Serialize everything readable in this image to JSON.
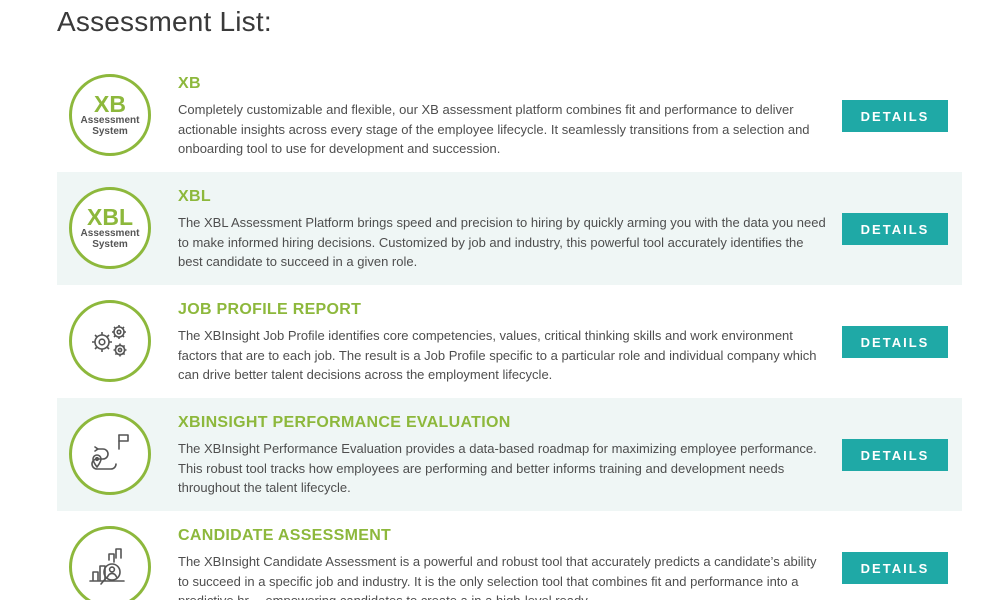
{
  "page": {
    "title": "Assessment List:"
  },
  "colors": {
    "accent": "#8db83c",
    "button": "#1fa9a6",
    "shaded_row": "#eff6f5"
  },
  "assessments": [
    {
      "logo": {
        "main": "XB",
        "sub": "Assessment System"
      },
      "icon": "xb-logo-icon",
      "title": "XB",
      "description": "Completely customizable and flexible, our XB assessment platform combines fit and performance to deliver actionable insights across every stage of the employee lifecycle. It seamlessly transitions from a selection and onboarding tool to use for development and succession.",
      "button": "DETAILS"
    },
    {
      "logo": {
        "main": "XBL",
        "sub": "Assessment System"
      },
      "icon": "xbl-logo-icon",
      "title": "XBL",
      "description": "The XBL Assessment Platform brings speed and precision to hiring by quickly arming you with the data you need to make informed hiring decisions. Customized by job and industry, this powerful tool accurately identifies the best candidate to succeed in a given role.",
      "button": "DETAILS"
    },
    {
      "icon": "gears-icon",
      "title": "JOB PROFILE REPORT",
      "description": "The XBInsight Job Profile identifies core competencies, values, critical thinking skills and work environment factors that are to each job. The result is a Job Profile specific to a particular role and individual company which can drive better talent decisions across the employment lifecycle.",
      "button": "DETAILS"
    },
    {
      "icon": "roadmap-icon",
      "title": "XBINSIGHT PERFORMANCE EVALUATION",
      "description": "The XBInsight Performance Evaluation provides a data-based roadmap for maximizing employee performance. This robust tool tracks how employees are performing and better informs training and development needs throughout the talent lifecycle.",
      "button": "DETAILS"
    },
    {
      "icon": "candidate-search-icon",
      "title": "CANDIDATE ASSESSMENT",
      "description": "The XBInsight Candidate Assessment is a powerful and robust tool that accurately predicts a candidate’s ability to succeed in a specific job and industry. It is the only selection tool that combines fit and performance into a predictive hr… empowering candidates to create a in a high-level ready",
      "button": "DETAILS"
    }
  ]
}
